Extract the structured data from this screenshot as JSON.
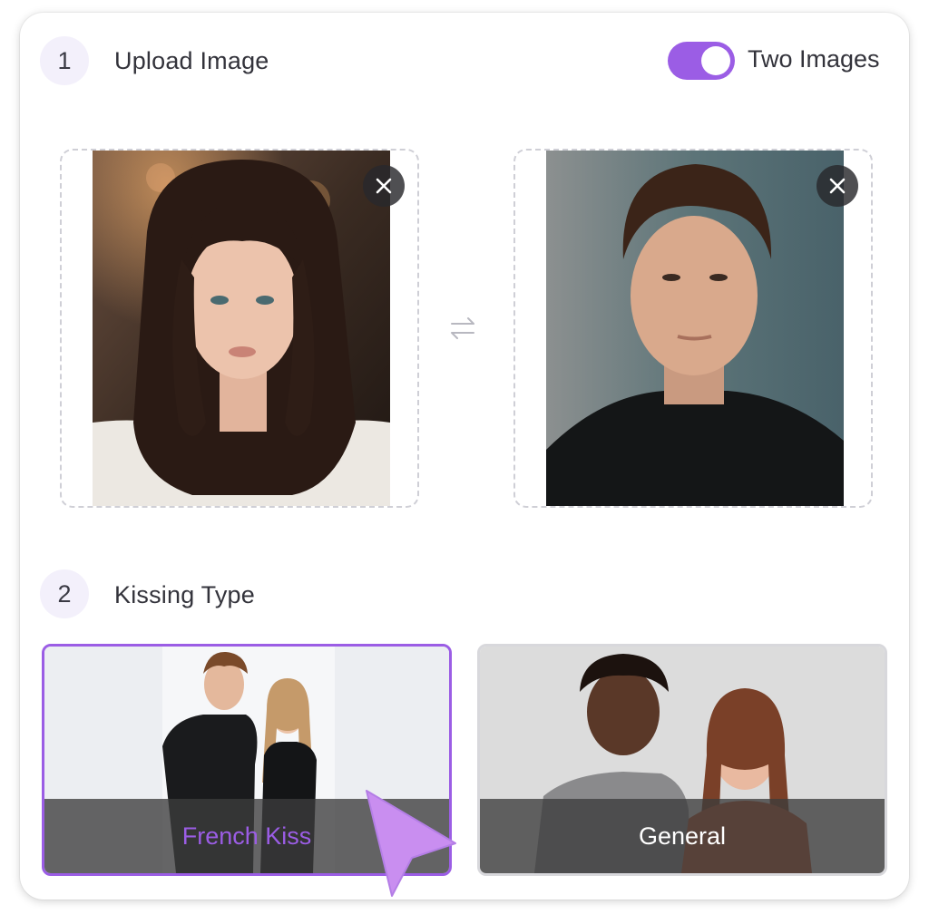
{
  "upload": {
    "step_number": "1",
    "title": "Upload Image",
    "toggle": {
      "label": "Two Images",
      "on": true
    }
  },
  "images": [
    {
      "name": "left-photo",
      "remove_icon": "close-icon"
    },
    {
      "name": "right-photo",
      "remove_icon": "close-icon"
    }
  ],
  "swap_icon": "swap-arrows-icon",
  "kissing": {
    "step_number": "2",
    "title": "Kissing Type",
    "options": [
      {
        "label": "French Kiss",
        "selected": true
      },
      {
        "label": "General",
        "selected": false
      }
    ]
  },
  "colors": {
    "accent": "#9b5de5",
    "step_bg": "#f3f0fb",
    "dashed_border": "#cfcfd6"
  }
}
